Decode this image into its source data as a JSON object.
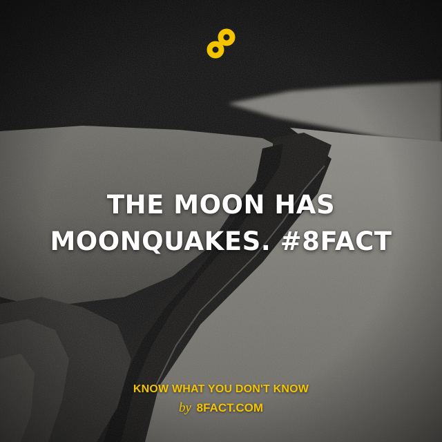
{
  "brand": {
    "logo_icon": "8fact-infinity-logo",
    "accent_color": "#f5c400"
  },
  "headline": {
    "line1": "THE MOON HAS",
    "line2": "MOONQUAKES. #8FACT",
    "color": "#ffffff"
  },
  "footer": {
    "tagline": "KNOW WHAT YOU DON'T KNOW",
    "by_word": "by",
    "site": "8FACT.COM"
  },
  "background": {
    "scene": "cracked-ground-photo"
  }
}
